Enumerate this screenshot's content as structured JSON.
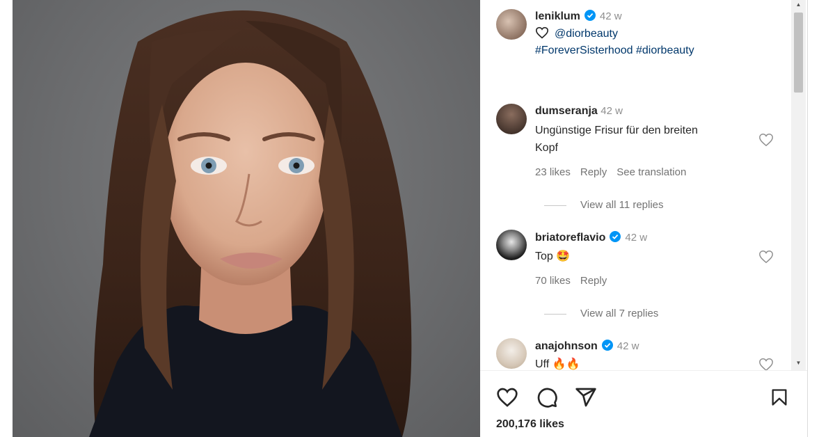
{
  "post": {
    "author": "leniklum",
    "time": "42 w",
    "caption_mention": "@diorbeauty",
    "caption_tags": "#ForeverSisterhood #diorbeauty",
    "likes": "200,176 likes"
  },
  "comments": [
    {
      "user": "dumseranja",
      "time": "42 w",
      "text": "Ungünstige Frisur für den breiten Kopf",
      "text_line1": "Ungünstige Frisur für den breiten",
      "text_line2": "Kopf",
      "likes": "23 likes",
      "reply": "Reply",
      "translate": "See translation",
      "view_replies": "View all 11 replies"
    },
    {
      "user": "briatoreflavio",
      "time": "42 w",
      "text": "Top 🤩",
      "likes": "70 likes",
      "reply": "Reply",
      "view_replies": "View all 7 replies"
    },
    {
      "user": "anajohnson",
      "time": "42 w",
      "text": "Uff 🔥🔥"
    }
  ],
  "colors": {
    "verified": "#0095f6",
    "link": "#00376b",
    "muted": "#737373"
  },
  "icons": [
    "heart-icon",
    "comment-icon",
    "share-icon",
    "bookmark-icon",
    "verified-badge-icon"
  ]
}
